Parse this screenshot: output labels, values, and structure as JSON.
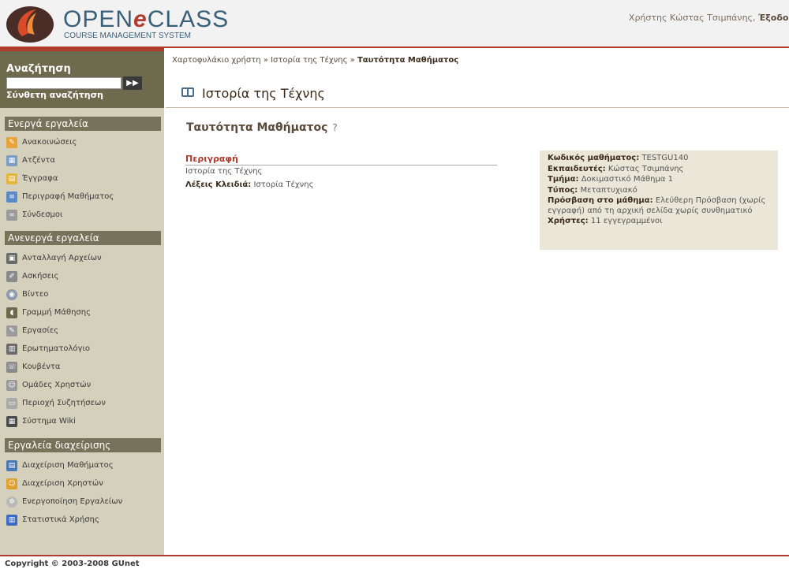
{
  "header": {
    "logo_main_1": "OPEN",
    "logo_main_2": "e",
    "logo_main_3": "CLASS",
    "logo_sub": "COURSE MANAGEMENT SYSTEM",
    "user_label": "Χρήστης Κώστας Τσιμπάνης,",
    "logout": "Έξοδος"
  },
  "search": {
    "title": "Αναζήτηση",
    "value": "",
    "button_label": "▶▶",
    "advanced": "Σύνθετη αναζήτηση"
  },
  "active_tools": {
    "title": "Ενεργά εργαλεία",
    "items": [
      "Ανακοινώσεις",
      "Ατζέντα",
      "Έγγραφα",
      "Περιγραφή Μαθήματος",
      "Σύνδεσμοι"
    ]
  },
  "inactive_tools": {
    "title": "Ανενεργά εργαλεία",
    "items": [
      "Ανταλλαγή Αρχείων",
      "Ασκήσεις",
      "Βίντεο",
      "Γραμμή Μάθησης",
      "Εργασίες",
      "Ερωτηματολόγιο",
      "Κουβέντα",
      "Ομάδες Χρηστών",
      "Περιοχή Συζητήσεων",
      "Σύστημα Wiki"
    ]
  },
  "admin_tools": {
    "title": "Εργαλεία διαχείρισης",
    "items": [
      "Διαχείριση Μαθήματος",
      "Διαχείριση Χρηστών",
      "Ενεργοποίηση Εργαλείων",
      "Στατιστικά Χρήσης"
    ]
  },
  "breadcrumb": {
    "items": [
      "Χαρτοφυλάκιο χρήστη",
      "Ιστορία της Τέχνης",
      "Ταυτότητα Μαθήματος"
    ],
    "sep": "»"
  },
  "page": {
    "title": "Ιστορία της Τέχνης",
    "section": "Ταυτότητα Μαθήματος",
    "help": "?"
  },
  "description": {
    "label": "Περιγραφή",
    "text": "Ιστορία της Τέχνης",
    "keywords_label": "Λέξεις Κλειδιά:",
    "keywords": "Ιστορία Τέχνης"
  },
  "info": {
    "code_label": "Κωδικός μαθήματος:",
    "code": "TESTGU140",
    "teacher_label": "Εκπαιδευτές:",
    "teacher": "Κώστας Τσιμπάνης",
    "dept_label": "Τμήμα:",
    "dept": "Δοκιμαστικό Μάθημα 1",
    "type_label": "Τύπος:",
    "type": "Μεταπτυχιακό",
    "access_label": "Πρόσβαση στο μάθημα:",
    "access": "Ελεύθερη Πρόσβαση (χωρίς εγγραφή) από τη αρχική σελίδα χωρίς συνθηματικό",
    "users_label": "Χρήστες:",
    "users": "11 εγγεγραμμένοι"
  },
  "footer": {
    "copyright": "Copyright © 2003-2008 GUnet"
  },
  "colors": {
    "accent": "#b03b2e",
    "sidebar": "#d4d0bc",
    "section_header": "#77735a",
    "search_bg": "#6e6a4d",
    "info_bg": "#ebe7d8"
  },
  "icons": {
    "active": [
      "megaphone-icon",
      "calendar-icon",
      "folder-icon",
      "document-icon",
      "link-icon"
    ],
    "inactive": [
      "file-exchange-icon",
      "exercise-icon",
      "video-icon",
      "footsteps-icon",
      "assignment-icon",
      "questionnaire-icon",
      "chat-icon",
      "users-group-icon",
      "forum-icon",
      "wiki-icon"
    ],
    "admin": [
      "course-admin-icon",
      "user-admin-icon",
      "tools-gear-icon",
      "stats-icon"
    ]
  }
}
